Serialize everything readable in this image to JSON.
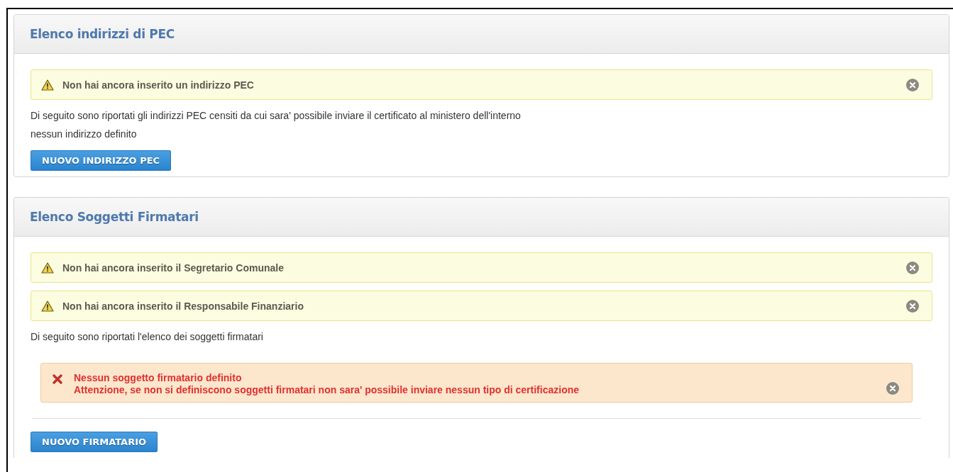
{
  "panels": [
    {
      "title": "Elenco indirizzi di PEC",
      "items": [
        {
          "kind": "warning",
          "text": "Non hai ancora inserito un indirizzo PEC"
        },
        {
          "kind": "text",
          "text": "Di seguito sono riportati gli indirizzi PEC censiti da cui sara' possibile inviare il certificato al ministero dell'interno"
        },
        {
          "kind": "text",
          "text": "nessun indirizzo definito"
        },
        {
          "kind": "button",
          "text": "NUOVO INDIRIZZO PEC"
        }
      ]
    },
    {
      "title": "Elenco Soggetti Firmatari",
      "items": [
        {
          "kind": "warning",
          "text": "Non hai ancora inserito il Segretario Comunale"
        },
        {
          "kind": "warning",
          "text": "Non hai ancora inserito il Responsabile Finanziario"
        },
        {
          "kind": "text",
          "text": "Di seguito sono riportati l'elenco dei soggetti firmatari"
        },
        {
          "kind": "error",
          "lines": [
            "Nessun soggetto firmatario definito",
            "Attenzione, se non si definiscono soggetti firmatari non sara' possibile inviare nessun tipo di certificazione"
          ]
        },
        {
          "kind": "button",
          "text": "NUOVO FIRMATARIO",
          "divider": true
        }
      ]
    }
  ]
}
